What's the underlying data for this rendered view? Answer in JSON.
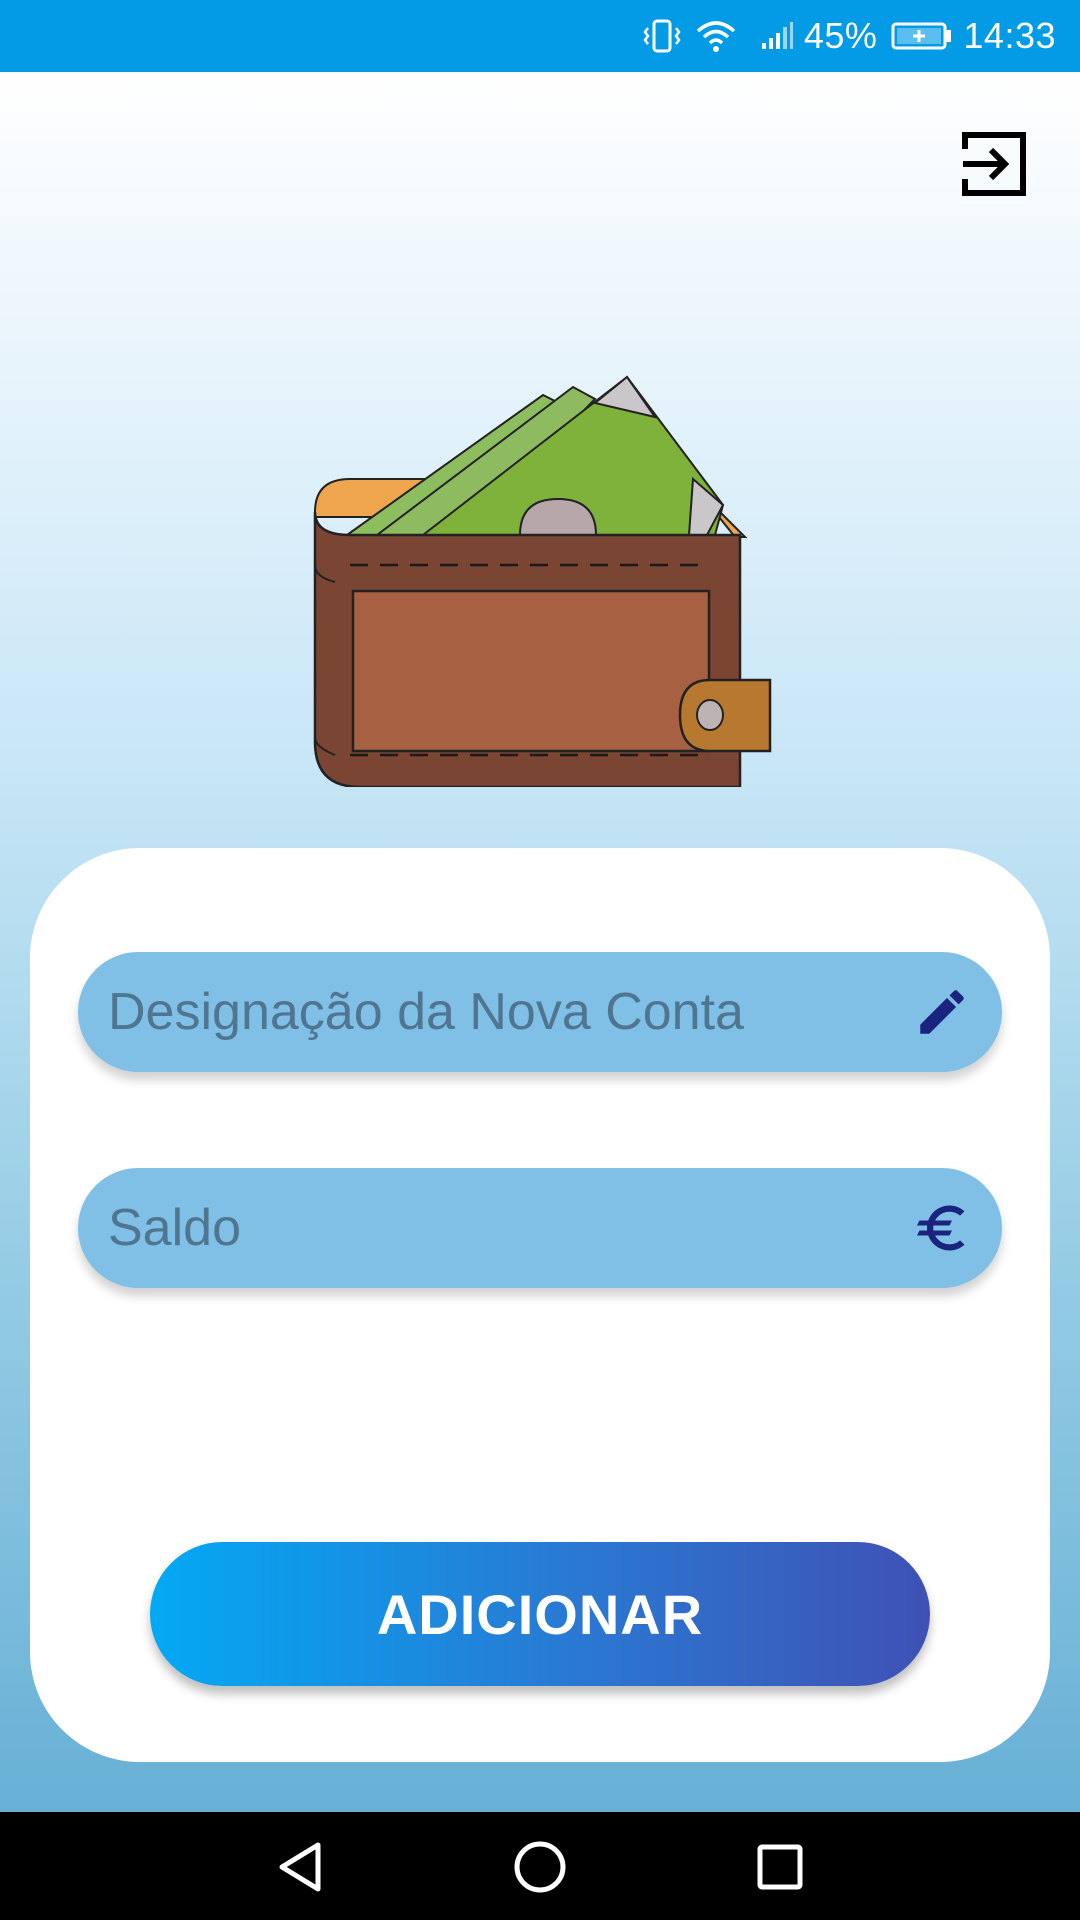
{
  "status_bar": {
    "battery_percent": "45%",
    "time": "14:33",
    "icons": [
      "vibrate-icon",
      "wifi-icon",
      "signal-icon",
      "battery-charging-icon"
    ]
  },
  "header": {
    "logout_icon": "exit-icon"
  },
  "illustration": {
    "name": "wallet-illustration"
  },
  "form": {
    "account_name": {
      "placeholder": "Designação da Nova Conta",
      "value": "",
      "icon": "pencil-icon"
    },
    "balance": {
      "placeholder": "Saldo",
      "value": "",
      "icon": "euro-icon"
    },
    "submit_label": "ADICIONAR"
  },
  "colors": {
    "status_bar": "#039be5",
    "field_bg": "#81c0e6",
    "icon_accent": "#1a237e",
    "button_start": "#03a9f4",
    "button_end": "#3f51b5"
  },
  "nav_bar": {
    "buttons": [
      "back-icon",
      "home-icon",
      "recents-icon"
    ]
  }
}
